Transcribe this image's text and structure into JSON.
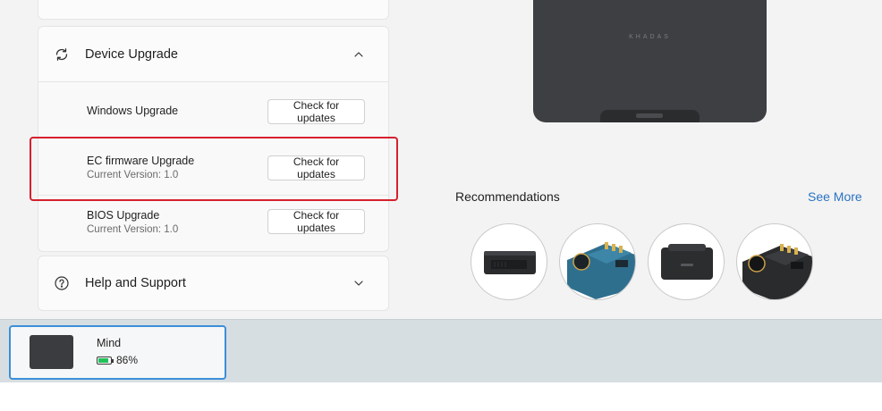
{
  "device_upgrade": {
    "title": "Device Upgrade",
    "icon": "refresh-icon",
    "expanded": true
  },
  "upgrades": [
    {
      "title": "Windows Upgrade",
      "button": "Check for updates"
    },
    {
      "title": "EC firmware Upgrade",
      "subtitle": "Current Version: 1.0",
      "button": "Check for updates"
    },
    {
      "title": "BIOS Upgrade",
      "subtitle": "Current Version: 1.0",
      "button": "Check for updates"
    }
  ],
  "help": {
    "title": "Help and Support",
    "icon": "help-icon",
    "expanded": false
  },
  "device_logo": "KHADAS",
  "recommendations": {
    "title": "Recommendations",
    "see_more": "See More",
    "items": [
      "mini-pc-icon",
      "board-blue-icon",
      "dock-icon",
      "board-dark-icon"
    ]
  },
  "device_card": {
    "name": "Mind",
    "battery_text": "86%",
    "battery_level": 0.86,
    "battery_color": "#22c25a"
  },
  "colors": {
    "accent": "#2a73c2",
    "highlight": "#d6202e",
    "selected_border": "#3c8fd8"
  }
}
